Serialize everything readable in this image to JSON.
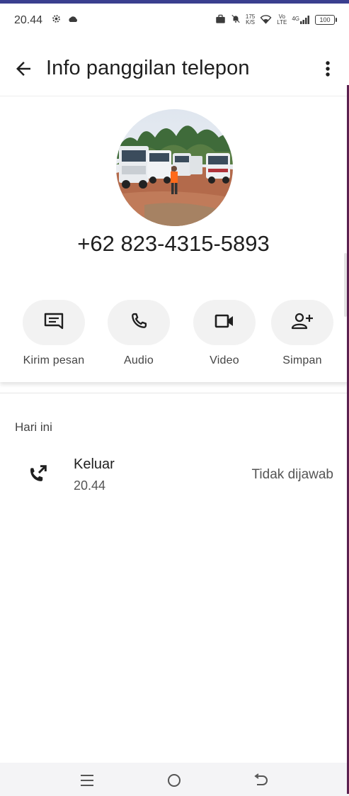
{
  "status_bar": {
    "time": "20.44",
    "speed_value": "175",
    "speed_unit": "K/S",
    "volte_top": "Vo",
    "volte_bottom": "LTE",
    "network": "4G",
    "battery": "100"
  },
  "app_bar": {
    "title": "Info panggilan telepon"
  },
  "contact": {
    "phone_number": "+62 823-4315-5893"
  },
  "actions": [
    {
      "label": "Kirim pesan",
      "icon": "message-icon"
    },
    {
      "label": "Audio",
      "icon": "phone-icon"
    },
    {
      "label": "Video",
      "icon": "videocam-icon"
    },
    {
      "label": "Simpan",
      "icon": "add-person-icon"
    }
  ],
  "history": {
    "section_title": "Hari ini",
    "entries": [
      {
        "type": "Keluar",
        "time": "20.44",
        "status": "Tidak dijawab",
        "icon": "outgoing-call-icon"
      }
    ]
  },
  "colors": {
    "text_primary": "#1f1f1f",
    "pill_bg": "#f2f2f2",
    "nav_bg": "#f4f4f6"
  }
}
